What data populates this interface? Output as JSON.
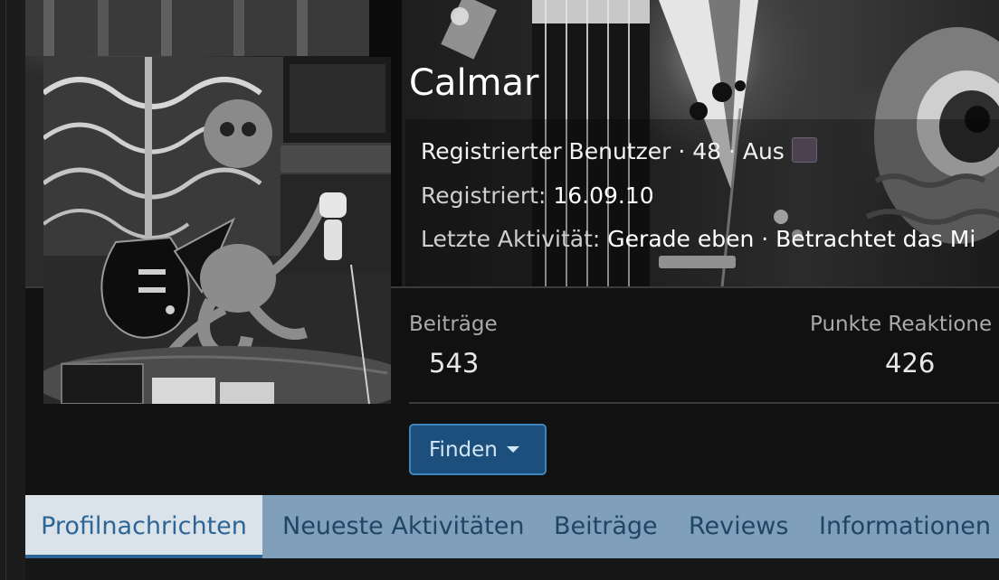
{
  "profile": {
    "username": "Calmar",
    "avatar_icon": "profile-photo-octopus-guitar",
    "role_prefix": "Registrierter Benutzer · 48 · Aus",
    "registered_label": "Registriert:",
    "registered_date": "16.09.10",
    "last_activity_label": "Letzte Aktivität:",
    "last_activity_value": "Gerade eben · Betrachtet das Mi"
  },
  "stats": [
    {
      "label": "Beiträge",
      "value": "543"
    },
    {
      "label": "Punkte Reaktione",
      "value": "426"
    }
  ],
  "actions": {
    "find_label": "Finden"
  },
  "tabs": [
    {
      "label": "Profilnachrichten",
      "active": true
    },
    {
      "label": "Neueste Aktivitäten",
      "active": false
    },
    {
      "label": "Beiträge",
      "active": false
    },
    {
      "label": "Reviews",
      "active": false
    },
    {
      "label": "Informationen",
      "active": false
    }
  ],
  "colors": {
    "accent": "#2d6596",
    "tab_bar": "#7f9fba",
    "button_bg": "#1d4f7c",
    "swatch": "#4a4250"
  }
}
